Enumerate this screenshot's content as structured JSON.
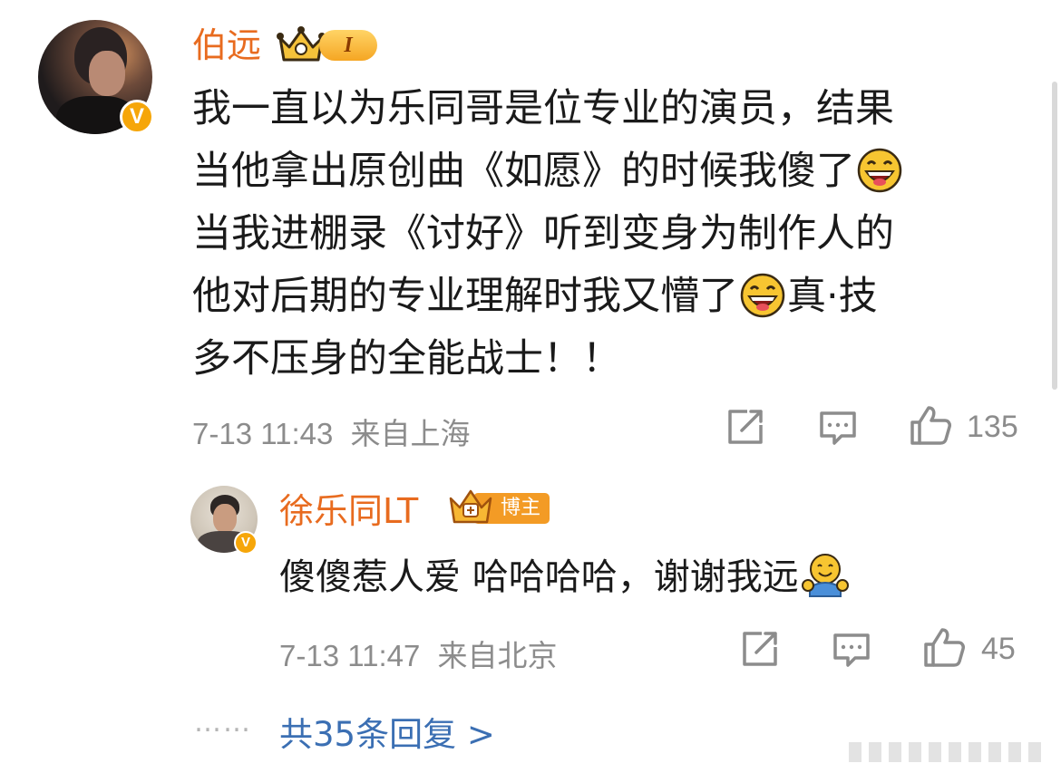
{
  "comment": {
    "username": "伯远",
    "level_badge": "I",
    "text_lines": [
      [
        "我一直以为乐同哥是位专业的演员，结果"
      ],
      [
        "当他拿出原创曲《如愿》的时候我傻了",
        "grin-emoji"
      ],
      [
        "当我进棚录《讨好》听到变身为制作人的"
      ],
      [
        "他对后期的专业理解时我又懵了",
        "grin-emoji",
        "真·技"
      ],
      [
        "多不压身的全能战士！！"
      ]
    ],
    "line1": "我一直以为乐同哥是位专业的演员，结果",
    "line2": "当他拿出原创曲《如愿》的时候我傻了",
    "line3": "当我进棚录《讨好》听到变身为制作人的",
    "line4a": "他对后期的专业理解时我又懵了",
    "line4b": "真·技",
    "line5": "多不压身的全能战士！！",
    "time": "7-13 11:43",
    "location": "来自上海",
    "likes": "135"
  },
  "reply": {
    "username": "徐乐同LT",
    "host_badge": "博主",
    "text": "傻傻惹人爱 哈哈哈哈，谢谢我远",
    "time": "7-13 11:47",
    "location": "来自北京",
    "likes": "45"
  },
  "more_replies": {
    "dots": "……",
    "label": "共35条回复 >"
  },
  "colors": {
    "username": "#e86b1f",
    "link": "#3b6fb3",
    "meta": "#8c8c8c",
    "verified": "#f6a609"
  },
  "icons": [
    "verified-badge-icon",
    "crown-icon",
    "grin-emoji",
    "hug-emoji",
    "share-icon",
    "comment-icon",
    "like-icon"
  ]
}
